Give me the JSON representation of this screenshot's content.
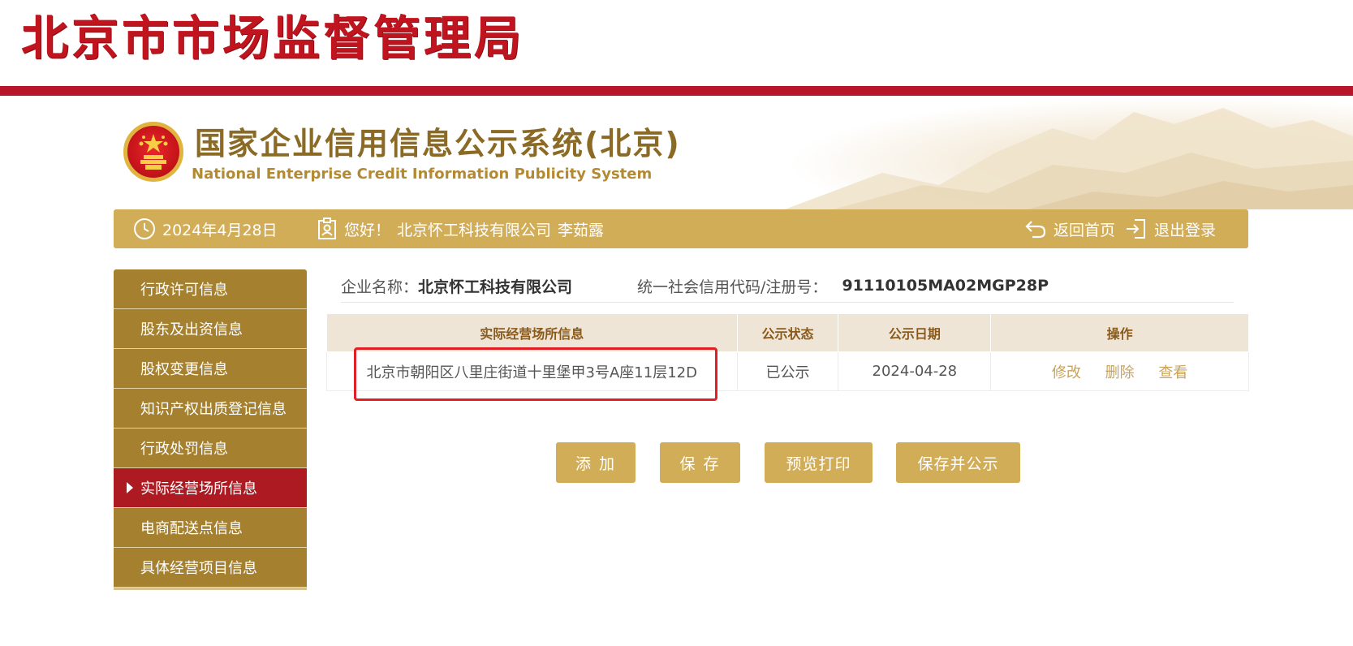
{
  "bureau": {
    "title": "北京市市场监督管理局"
  },
  "system": {
    "title_cn": "国家企业信用信息公示系统(北京)",
    "title_en": "National Enterprise Credit Information Publicity System"
  },
  "topbar": {
    "date": "2024年4月28日",
    "greeting": "您好！",
    "company": "北京怀工科技有限公司",
    "user": "李茹露",
    "home_label": "返回首页",
    "logout_label": "退出登录"
  },
  "sidebar": {
    "items": [
      {
        "label": "行政许可信息",
        "active": false
      },
      {
        "label": "股东及出资信息",
        "active": false
      },
      {
        "label": "股权变更信息",
        "active": false
      },
      {
        "label": "知识产权出质登记信息",
        "active": false
      },
      {
        "label": "行政处罚信息",
        "active": false
      },
      {
        "label": "实际经营场所信息",
        "active": true
      },
      {
        "label": "电商配送点信息",
        "active": false
      },
      {
        "label": "具体经营项目信息",
        "active": false
      }
    ]
  },
  "company_info": {
    "name_label": "企业名称：",
    "name_value": "北京怀工科技有限公司",
    "code_label": "统一社会信用代码/注册号：",
    "code_value": "91110105MA02MGP28P"
  },
  "table": {
    "headers": [
      "实际经营场所信息",
      "公示状态",
      "公示日期",
      "操作"
    ],
    "rows": [
      {
        "address": "北京市朝阳区八里庄街道十里堡甲3号A座11层12D",
        "status": "已公示",
        "date": "2024-04-28",
        "ops": [
          "修改",
          "删除",
          "查看"
        ]
      }
    ]
  },
  "buttons": {
    "add": "添 加",
    "save": "保 存",
    "preview": "预览打印",
    "save_publish": "保存并公示"
  },
  "colors": {
    "brand_red": "#b8162a",
    "gold": "#d2ad58",
    "sidebar_gold": "#a5802e",
    "active_red": "#ad1a22",
    "highlight": "#e01f26"
  }
}
